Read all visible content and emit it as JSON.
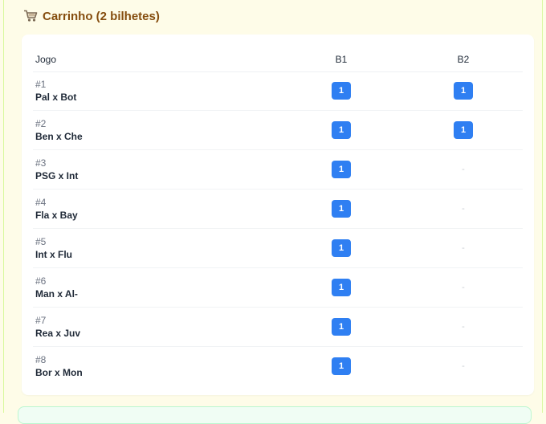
{
  "cart": {
    "title": "Carrinho (2 bilhetes)",
    "icon": "shopping-cart-icon"
  },
  "table": {
    "headers": {
      "game": "Jogo",
      "b1": "B1",
      "b2": "B2"
    },
    "rows": [
      {
        "num": "#1",
        "match": "Pal x Bot",
        "b1": "1",
        "b2": "1"
      },
      {
        "num": "#2",
        "match": "Ben x Che",
        "b1": "1",
        "b2": "1"
      },
      {
        "num": "#3",
        "match": "PSG x Int",
        "b1": "1",
        "b2": "-"
      },
      {
        "num": "#4",
        "match": "Fla x Bay",
        "b1": "1",
        "b2": "-"
      },
      {
        "num": "#5",
        "match": "Int x Flu",
        "b1": "1",
        "b2": "-"
      },
      {
        "num": "#6",
        "match": "Man x Al-",
        "b1": "1",
        "b2": "-"
      },
      {
        "num": "#7",
        "match": "Rea x Juv",
        "b1": "1",
        "b2": "-"
      },
      {
        "num": "#8",
        "match": "Bor x Mon",
        "b1": "1",
        "b2": "-"
      }
    ]
  },
  "colors": {
    "badge": "#2f7ff2",
    "title": "#854d0e",
    "background": "#fefce8"
  }
}
